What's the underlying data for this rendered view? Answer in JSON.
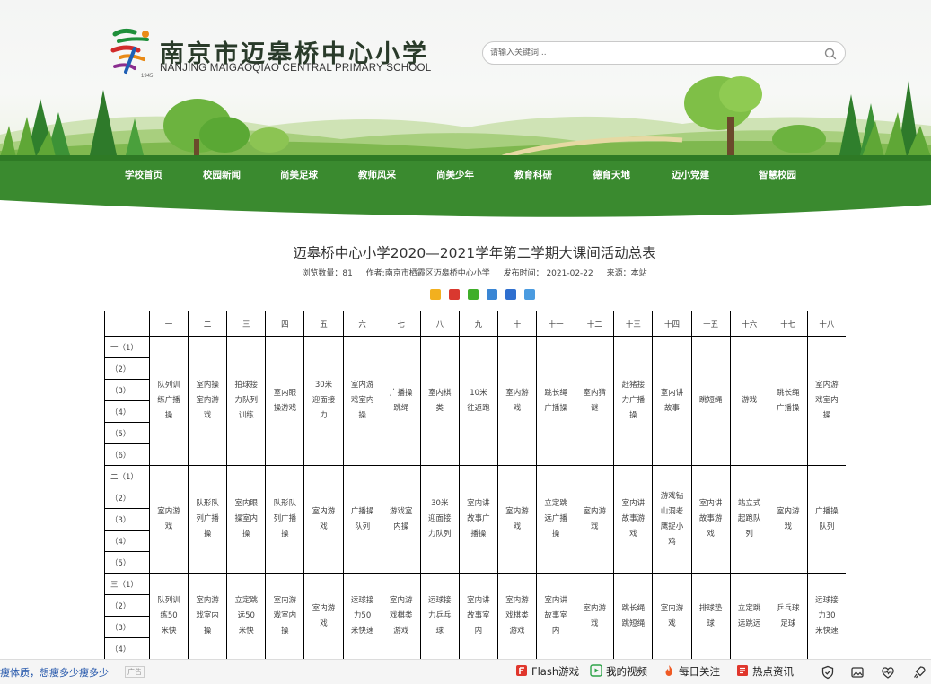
{
  "header": {
    "school_name_cn": "南京市迈皋桥中心小学",
    "school_name_en": "NANJING MAIGAOQIAO CENTRAL PRIMARY SCHOOL",
    "logo_year": "1945",
    "search_placeholder": "请输入关键词..."
  },
  "nav": {
    "items": [
      "学校首页",
      "校园新闻",
      "尚美足球",
      "教师风采",
      "尚美少年",
      "教育科研",
      "德育天地",
      "迈小党建",
      "智慧校园"
    ]
  },
  "article": {
    "title": "迈皋桥中心小学2020—2021学年第二学期大课间活动总表",
    "views_label": "浏览数量：81",
    "author_label": "作者:南京市栖霞区迈皋桥中心小学",
    "date_label": "发布时间： 2021-02-22",
    "source_label": "来源：本站"
  },
  "schedule": {
    "weeks": [
      "一",
      "二",
      "三",
      "四",
      "五",
      "六",
      "七",
      "八",
      "九",
      "十",
      "十一",
      "十二",
      "十三",
      "十四",
      "十五",
      "十六",
      "十七",
      "十八"
    ],
    "grades": [
      {
        "rows": [
          "一（1）",
          "（2）",
          "（3）",
          "（4）",
          "（5）",
          "（6）"
        ],
        "activities": [
          "队列训练广播操",
          "室内操室内游戏",
          "拍球接力队列训练",
          "室内眼操游戏",
          "30米迎面接力",
          "室内游戏室内操",
          "广播操跳绳",
          "室内棋类",
          "10米往返跑",
          "室内游戏",
          "跳长绳广播操",
          "室内猜谜",
          "赶猪接力广播操",
          "室内讲故事",
          "跳短绳",
          "游戏",
          "跳长绳广播操",
          "室内游戏室内操"
        ]
      },
      {
        "rows": [
          "二（1）",
          "（2）",
          "（3）",
          "（4）",
          "（5）"
        ],
        "activities": [
          "室内游戏",
          "队形队列广播操",
          "室内眼操室内操",
          "队形队列广播操",
          "室内游戏",
          "广播操队列",
          "游戏室内操",
          "30米迎面接力队列",
          "室内讲故事广播操",
          "室内游戏",
          "立定跳远广播操",
          "室内游戏",
          "室内讲故事游戏",
          "游戏钻山洞老鹰捉小鸡",
          "室内讲故事游戏",
          "站立式起跑队列",
          "室内游戏",
          "广播操队列"
        ]
      },
      {
        "rows": [
          "三（1）",
          "（2）",
          "（3）",
          "（4）"
        ],
        "activities": [
          "队列训练50米快",
          "室内游戏室内操",
          "立定跳远50米快",
          "室内游戏室内操",
          "室内游戏",
          "运球接力50米快速",
          "室内游戏棋类游戏",
          "运球接力乒乓球",
          "室内讲故事室内",
          "室内游戏棋类游戏",
          "室内讲故事室内",
          "室内游戏",
          "跳长绳跳短绳",
          "室内游戏",
          "排球垫球",
          "立定跳远跳远",
          "乒乓球足球",
          "运球接力30米快速"
        ]
      }
    ]
  },
  "bottombar": {
    "ad_text": "瘦体质，想瘦多少瘦多少",
    "ad_tag": "广告",
    "items": [
      "Flash游戏",
      "我的视频",
      "每日关注",
      "热点资讯"
    ]
  }
}
